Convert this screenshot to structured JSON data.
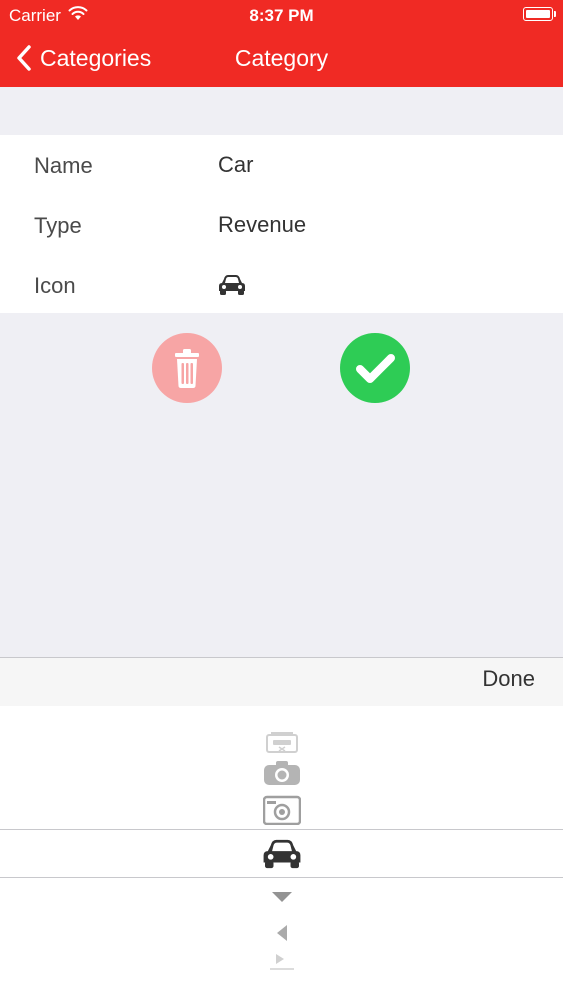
{
  "status_bar": {
    "carrier": "Carrier",
    "time": "8:37 PM"
  },
  "nav": {
    "back_label": "Categories",
    "title": "Category"
  },
  "form": {
    "rows": [
      {
        "label": "Name",
        "value": "Car"
      },
      {
        "label": "Type",
        "value": "Revenue"
      },
      {
        "label": "Icon",
        "value_icon": "car-icon"
      }
    ]
  },
  "actions": {
    "delete": {
      "icon": "trash-icon",
      "color": "#f7a5a5"
    },
    "confirm": {
      "icon": "checkmark-icon",
      "color": "#2ecc55"
    }
  },
  "toolbar": {
    "done_label": "Done"
  },
  "picker": {
    "items": [
      "cassette-icon",
      "camera-icon",
      "photo-camera-icon",
      "car-icon",
      "caret-down-icon",
      "caret-left-icon",
      "caret-right-icon"
    ],
    "selected": "car-icon"
  },
  "colors": {
    "nav_bar": "#f02a24",
    "background": "#efeff4",
    "delete": "#f7a5a5",
    "confirm": "#2ecc55"
  }
}
